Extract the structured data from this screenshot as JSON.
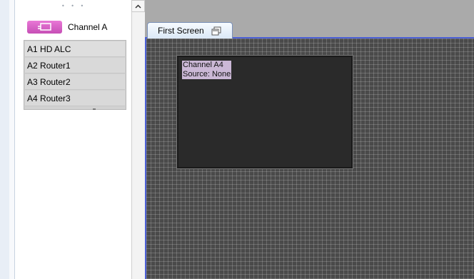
{
  "sidebar": {
    "channel_label": "Channel A",
    "sources": [
      {
        "id": "A1",
        "name": "HD ALC"
      },
      {
        "id": "A2",
        "name": "Router1"
      },
      {
        "id": "A3",
        "name": "Router2"
      },
      {
        "id": "A4",
        "name": "Router3"
      }
    ],
    "channel_icon": "channel-icon"
  },
  "tabs": {
    "first_screen_label": "First Screen"
  },
  "window": {
    "channel_line": "Channel A4",
    "source_line": "Source: None"
  },
  "colors": {
    "accent": "#4b5fd6",
    "channel_icon": "#d85ec7",
    "window_label_bg": "#cbb8d6"
  }
}
